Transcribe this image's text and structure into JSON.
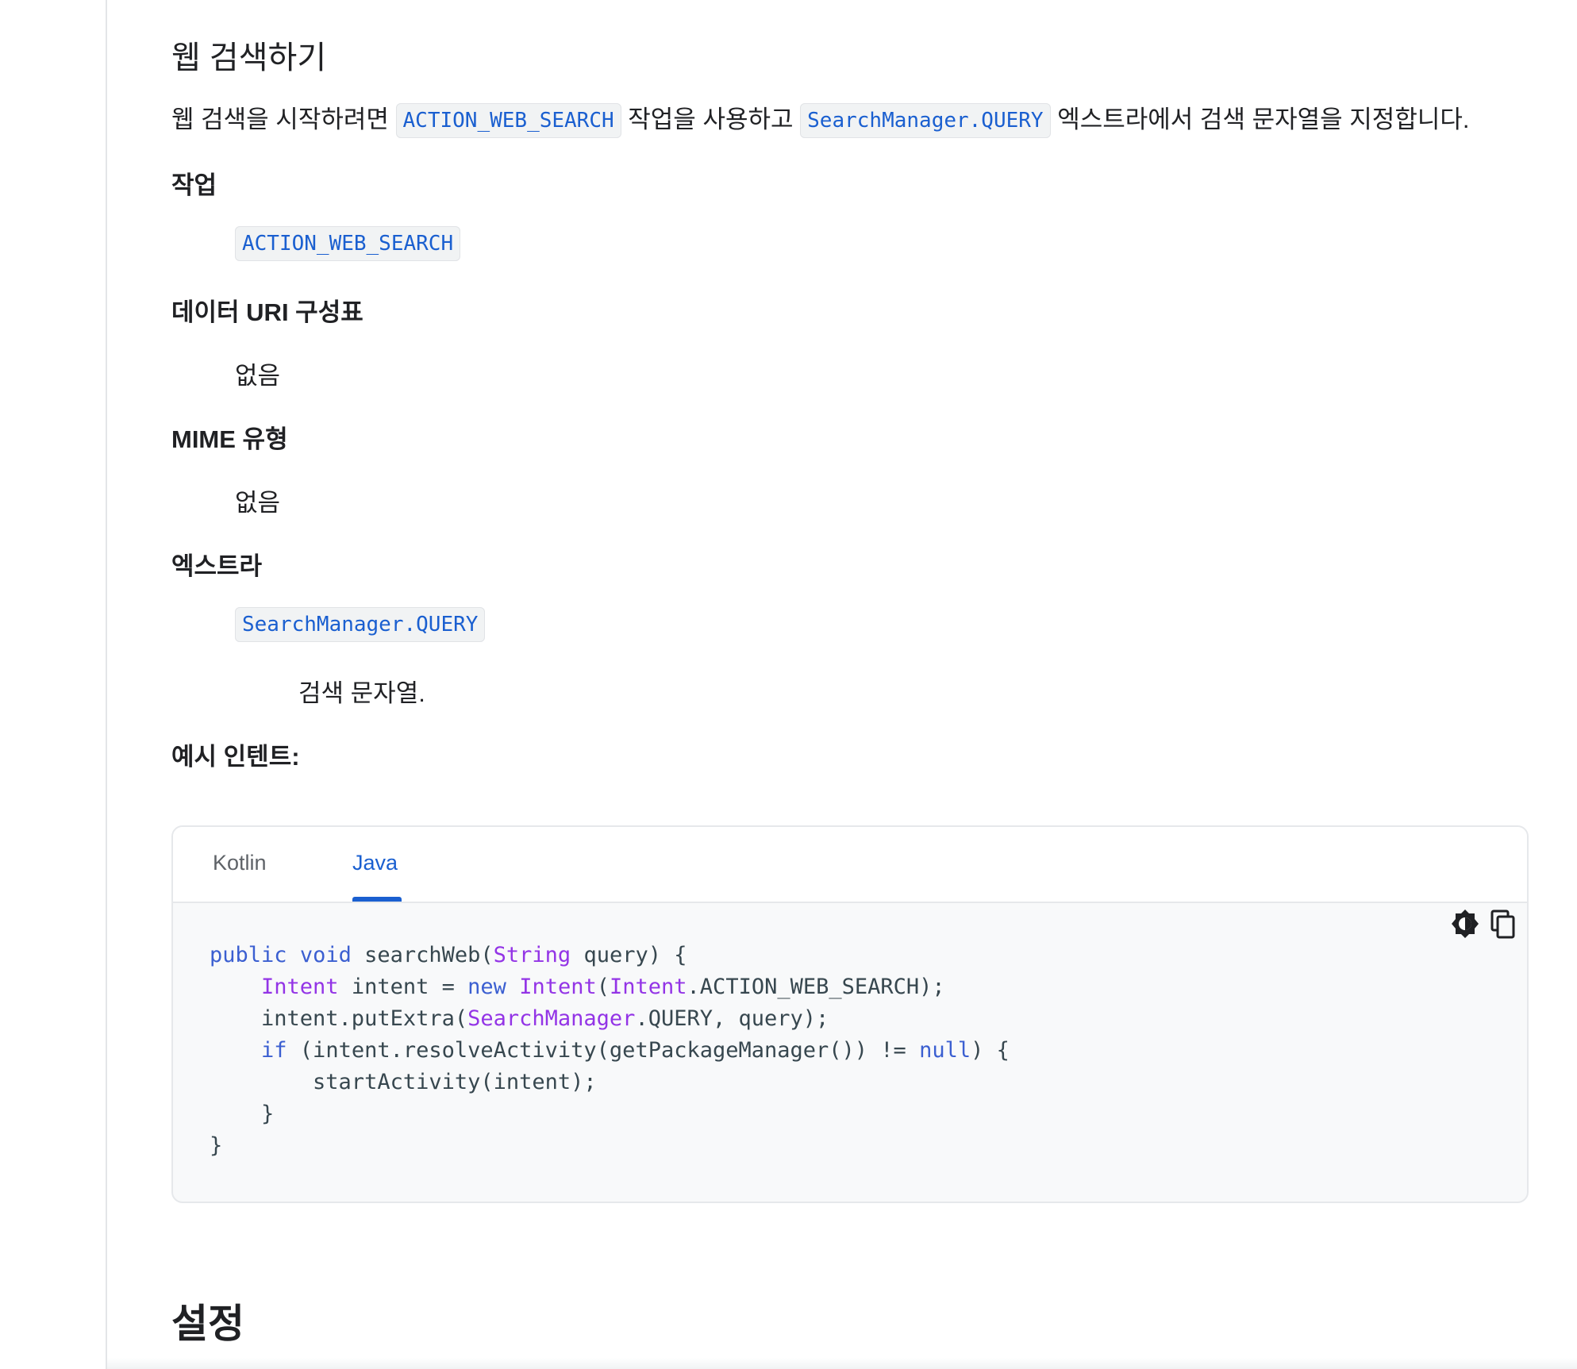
{
  "section": {
    "title": "웹 검색하기",
    "intro": {
      "part1": "웹 검색을 시작하려면",
      "code1": "ACTION_WEB_SEARCH",
      "part2": "작업을 사용하고",
      "code2": "SearchManager.QUERY",
      "part3": "엑스트라에서 검색 문자열을 지정합니다."
    }
  },
  "definitions": {
    "action": {
      "term": "작업",
      "value": "ACTION_WEB_SEARCH"
    },
    "data_uri": {
      "term": "데이터 URI 구성표",
      "value": "없음"
    },
    "mime": {
      "term": "MIME 유형",
      "value": "없음"
    },
    "extras": {
      "term": "엑스트라",
      "key": "SearchManager.QUERY",
      "description": "검색 문자열."
    },
    "example": {
      "term": "예시 인텐트:"
    }
  },
  "code_block": {
    "tabs": [
      {
        "label": "Kotlin",
        "active": false
      },
      {
        "label": "Java",
        "active": true
      }
    ],
    "tools": [
      "theme-toggle-icon",
      "copy-icon"
    ],
    "language": "Java",
    "lines": [
      "public void searchWeb(String query) {",
      "    Intent intent = new Intent(Intent.ACTION_WEB_SEARCH);",
      "    intent.putExtra(SearchManager.QUERY, query);",
      "    if (intent.resolveActivity(getPackageManager()) != null) {",
      "        startActivity(intent);",
      "    }",
      "}"
    ]
  },
  "next_section": {
    "title": "설정"
  },
  "colors": {
    "link_code": "#1a5fd0",
    "keyword": "#3b5fd1",
    "type": "#9334e6",
    "text": "#202124"
  }
}
